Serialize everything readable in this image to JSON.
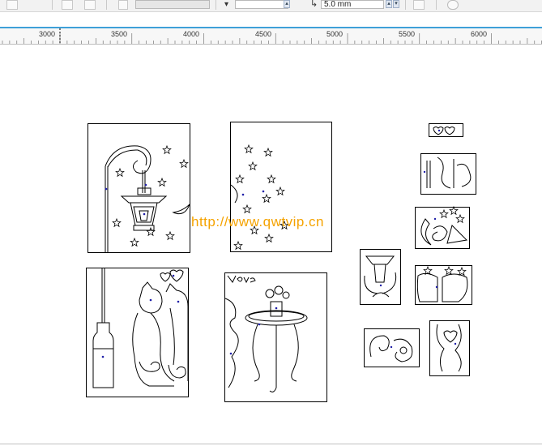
{
  "toolbar": {
    "nudge_value": "5.0 mm",
    "nudge_icon": "nudge-offset-icon"
  },
  "ruler": {
    "labels": [
      "3000",
      "3500",
      "4000",
      "4500",
      "5000",
      "5500",
      "6000"
    ]
  },
  "watermark": {
    "text": "http://www.qwtvip.cn"
  },
  "colors": {
    "accent": "#3ea0d8",
    "watermark": "#f5a300",
    "outline": "#000000",
    "node_marker": "#1f1fa8"
  }
}
